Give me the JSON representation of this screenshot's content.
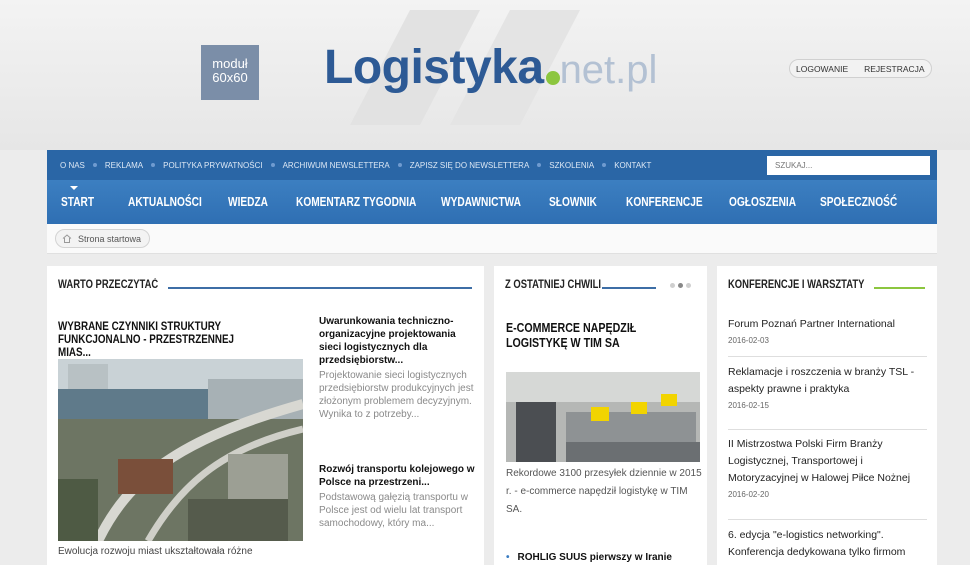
{
  "header": {
    "ad": {
      "line1": "moduł",
      "line2": "60x60"
    },
    "logo": {
      "main": "Logistyka",
      "suffix": "net.pl"
    },
    "auth": {
      "login": "LOGOWANIE",
      "register": "REJESTRACJA"
    }
  },
  "topnav": {
    "items": [
      "O NAS",
      "REKLAMA",
      "POLITYKA PRYWATNOŚCI",
      "ARCHIWUM NEWSLETTERA",
      "ZAPISZ SIĘ DO NEWSLETTERA",
      "SZKOLENIA",
      "KONTAKT"
    ],
    "search_placeholder": "SZUKAJ..."
  },
  "mainnav": {
    "items": [
      "START",
      "AKTUALNOŚCI",
      "WIEDZA",
      "KOMENTARZ TYGODNIA",
      "WYDAWNICTWA",
      "SŁOWNIK",
      "KONFERENCJE",
      "OGŁOSZENIA",
      "SPOŁECZNOŚĆ"
    ],
    "active": "START"
  },
  "breadcrumb": {
    "home_label": "Strona startowa"
  },
  "worth_reading": {
    "heading": "WARTO PRZECZYTAĆ",
    "featured": {
      "title": "WYBRANE CZYNNIKI STRUKTURY FUNKCJONALNO - PRZESTRZENNEJ MIAS...",
      "desc": "Ewolucja rozwoju miast ukształtowała różne"
    },
    "side_articles": [
      {
        "title": "Uwarunkowania techniczno-organizacyjne projektowania sieci logistycznych dla przedsiębiorstw...",
        "desc": "Projektowanie sieci logistycznych przedsiębiorstw produkcyjnych jest złożonym problemem decyzyjnym. Wynika to z potrzeby..."
      },
      {
        "title": "Rozwój transportu kolejowego w Polsce na przestrzeni...",
        "desc": "Podstawową gałęzią transportu w Polsce jest od wielu lat transport samochodowy, który ma..."
      }
    ]
  },
  "latest": {
    "heading": "Z OSTATNIEJ CHWILI",
    "title": "E-COMMERCE NAPĘDZIŁ LOGISTYKĘ W TIM SA",
    "desc": "Rekordowe 3100 przesyłek dziennie w 2015 r. - e-commerce napędził logistykę w TIM SA.",
    "bullet": "ROHLIG SUUS pierwszy w Iranie"
  },
  "conferences": {
    "heading": "KONFERENCJE I WARSZTATY",
    "items": [
      {
        "title": "Forum Poznań Partner International",
        "date": "2016-02-03"
      },
      {
        "title": "Reklamacje i roszczenia w branży TSL - aspekty prawne i praktyka",
        "date": "2016-02-15"
      },
      {
        "title": "II Mistrzostwa Polski Firm Branży Logistycznej, Transportowej i Motoryzacyjnej w Halowej Piłce Nożnej",
        "date": "2016-02-20"
      },
      {
        "title": "6. edycja \"e-logistics networking\". Konferencja dedykowana tylko firmom"
      }
    ]
  },
  "colors": {
    "brand_blue": "#2d5a95",
    "nav_blue": "#2f6fb3",
    "accent_green": "#8cc63f",
    "logo_suffix": "#b3c1d3"
  }
}
